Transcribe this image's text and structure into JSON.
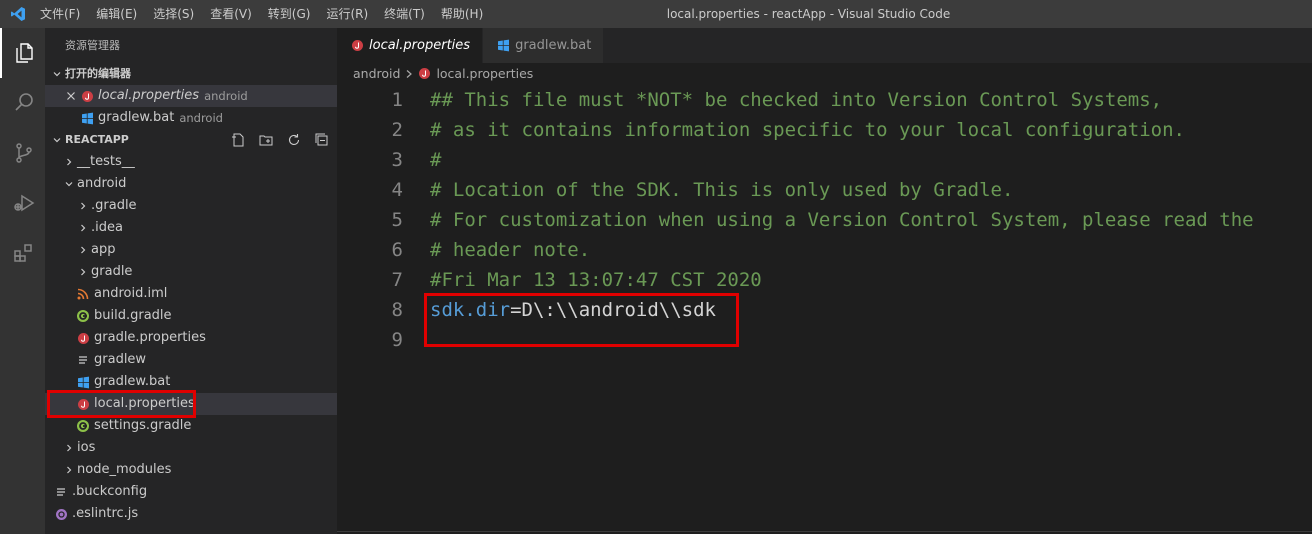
{
  "titlebar": {
    "menu": [
      "文件(F)",
      "编辑(E)",
      "选择(S)",
      "查看(V)",
      "转到(G)",
      "运行(R)",
      "终端(T)",
      "帮助(H)"
    ],
    "window_title": "local.properties - reactApp - Visual Studio Code"
  },
  "activitybar": {
    "icons": [
      "explorer-icon",
      "search-icon",
      "source-control-icon",
      "run-debug-icon",
      "extensions-icon"
    ]
  },
  "sidebar": {
    "title": "资源管理器",
    "open_editors": {
      "header": "打开的编辑器",
      "items": [
        {
          "name": "local.properties",
          "desc": "android"
        },
        {
          "name": "gradlew.bat",
          "desc": "android"
        }
      ]
    },
    "project": {
      "header": "REACTAPP",
      "tree": [
        {
          "label": "__tests__",
          "type": "folder",
          "level": 0,
          "open": false
        },
        {
          "label": "android",
          "type": "folder",
          "level": 0,
          "open": true
        },
        {
          "label": ".gradle",
          "type": "folder",
          "level": 1,
          "open": false
        },
        {
          "label": ".idea",
          "type": "folder",
          "level": 1,
          "open": false
        },
        {
          "label": "app",
          "type": "folder",
          "level": 1,
          "open": false
        },
        {
          "label": "gradle",
          "type": "folder",
          "level": 1,
          "open": false
        },
        {
          "label": "android.iml",
          "type": "rss",
          "level": 1
        },
        {
          "label": "build.gradle",
          "type": "gradle",
          "level": 1
        },
        {
          "label": "gradle.properties",
          "type": "java",
          "level": 1
        },
        {
          "label": "gradlew",
          "type": "text",
          "level": 1
        },
        {
          "label": "gradlew.bat",
          "type": "windows",
          "level": 1
        },
        {
          "label": "local.properties",
          "type": "java",
          "level": 1,
          "selected": true
        },
        {
          "label": "settings.gradle",
          "type": "gradle",
          "level": 1
        },
        {
          "label": "ios",
          "type": "folder",
          "level": 0,
          "open": false
        },
        {
          "label": "node_modules",
          "type": "folder",
          "level": 0,
          "open": false
        },
        {
          "label": ".buckconfig",
          "type": "text",
          "level": -1
        },
        {
          "label": ".eslintrc.js",
          "type": "eslint",
          "level": -1
        }
      ]
    }
  },
  "editor": {
    "tabs": [
      {
        "label": "local.properties",
        "active": true,
        "icon": "java-icon"
      },
      {
        "label": "gradlew.bat",
        "active": false,
        "icon": "windows-icon"
      }
    ],
    "breadcrumbs": [
      "android",
      "local.properties"
    ],
    "lines": [
      {
        "n": "1",
        "text": "## This file must *NOT* be checked into Version Control Systems,"
      },
      {
        "n": "2",
        "text": "# as it contains information specific to your local configuration."
      },
      {
        "n": "3",
        "text": "#"
      },
      {
        "n": "4",
        "text": "# Location of the SDK. This is only used by Gradle."
      },
      {
        "n": "5",
        "text": "# For customization when using a Version Control System, please read the"
      },
      {
        "n": "6",
        "text": "# header note."
      },
      {
        "n": "7",
        "text": "#Fri Mar 13 13:07:47 CST 2020"
      },
      {
        "n": "8",
        "key": "sdk.dir",
        "value": "=D\\:\\\\android\\\\sdk"
      },
      {
        "n": "9",
        "text": ""
      }
    ]
  },
  "colors": {
    "accent_blue": "#0078d4",
    "comment_green": "#6a9955",
    "key_blue": "#569cd6",
    "highlight_red": "#e00000",
    "java_red": "#cc3e44",
    "gradle_green": "#8dc149"
  }
}
